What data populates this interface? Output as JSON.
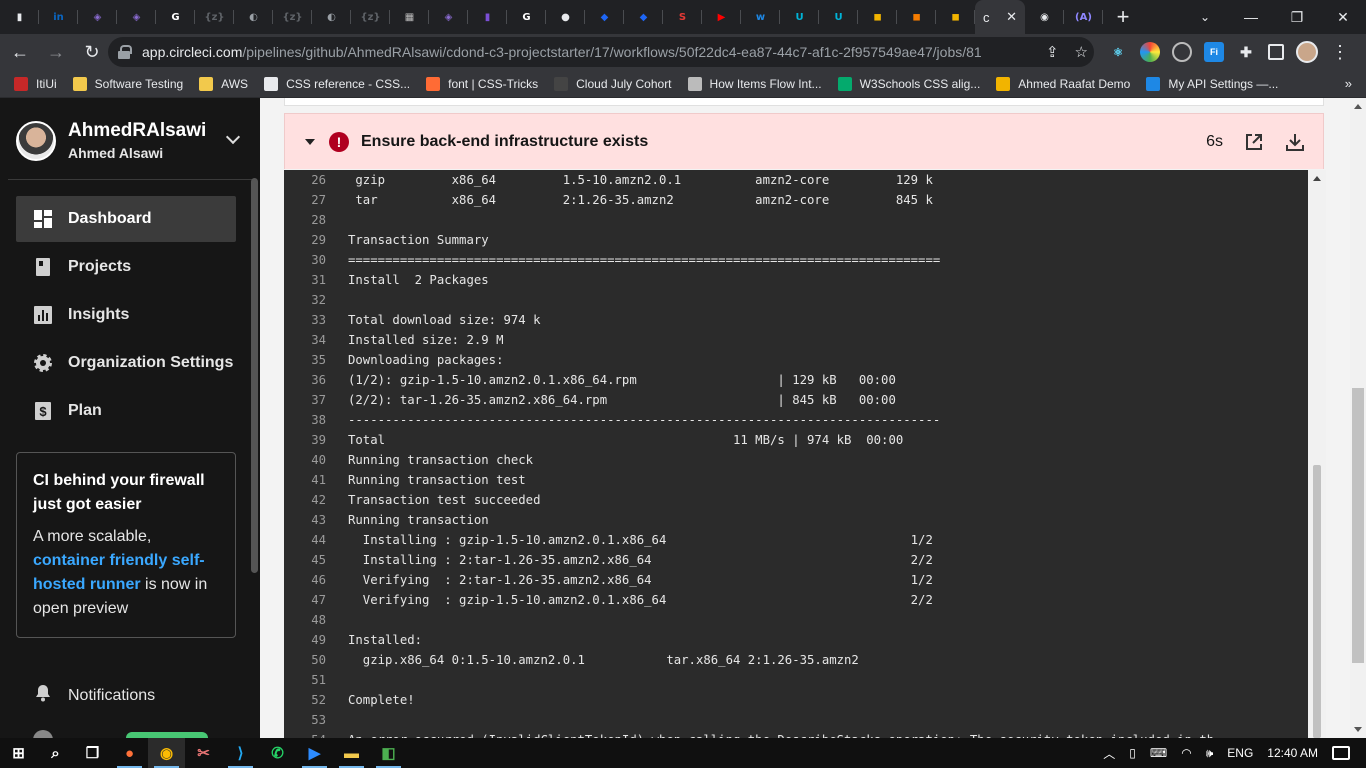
{
  "browser": {
    "active_tab_label": "c",
    "url_host": "app.circleci.com",
    "url_path": "/pipelines/github/AhmedRAlsawi/cdond-c3-projectstarter/17/workflows/50f22dc4-ea87-44c7-af1c-2f957549ae47/jobs/81",
    "pinned_tabs": [
      {
        "icon": "bookmark-icon",
        "color": "#e8eaed",
        "glyph": "▮"
      },
      {
        "icon": "linkedin-icon",
        "color": "#0a66c2",
        "glyph": "in"
      },
      {
        "icon": "graphql-icon",
        "color": "#8a6bd1",
        "glyph": "◈"
      },
      {
        "icon": "graphql-icon",
        "color": "#8a6bd1",
        "glyph": "◈"
      },
      {
        "icon": "google-icon",
        "color": "#ffffff",
        "glyph": "G"
      },
      {
        "icon": "zeplin-icon",
        "color": "#5f6368",
        "glyph": "{z}"
      },
      {
        "icon": "globe-icon",
        "color": "#9aa0a6",
        "glyph": "◐"
      },
      {
        "icon": "zeplin-icon",
        "color": "#5f6368",
        "glyph": "{z}"
      },
      {
        "icon": "globe-icon",
        "color": "#9aa0a6",
        "glyph": "◐"
      },
      {
        "icon": "zeplin-icon",
        "color": "#5f6368",
        "glyph": "{z}"
      },
      {
        "icon": "image-icon",
        "color": "#bdbdbd",
        "glyph": "▦"
      },
      {
        "icon": "graphql-icon",
        "color": "#8a6bd1",
        "glyph": "◈"
      },
      {
        "icon": "onenote-icon",
        "color": "#7b4fd6",
        "glyph": "▮"
      },
      {
        "icon": "google-icon",
        "color": "#ffffff",
        "glyph": "G"
      },
      {
        "icon": "github-icon",
        "color": "#e8eaed",
        "glyph": "●"
      },
      {
        "icon": "layer-icon",
        "color": "#1e66f5",
        "glyph": "◆"
      },
      {
        "icon": "layer-icon",
        "color": "#1e66f5",
        "glyph": "◆"
      },
      {
        "icon": "s-icon",
        "color": "#e53935",
        "glyph": "S"
      },
      {
        "icon": "youtube-icon",
        "color": "#ff0000",
        "glyph": "▶"
      },
      {
        "icon": "w-icon",
        "color": "#1e88e5",
        "glyph": "w"
      },
      {
        "icon": "udacity-icon",
        "color": "#00b4d8",
        "glyph": "U"
      },
      {
        "icon": "udacity-icon",
        "color": "#00b4d8",
        "glyph": "U"
      },
      {
        "icon": "box-icon",
        "color": "#f2b400",
        "glyph": "◼"
      },
      {
        "icon": "box-icon",
        "color": "#f57c00",
        "glyph": "◼"
      },
      {
        "icon": "box-icon",
        "color": "#f2b400",
        "glyph": "◼"
      }
    ],
    "after_tabs": [
      {
        "icon": "circleci-icon",
        "color": "#e8eaed",
        "glyph": "◉"
      },
      {
        "icon": "angular-icon",
        "color": "#8f87ff",
        "glyph": "(A)"
      }
    ],
    "bookmarks": [
      {
        "label": "ItiUi",
        "icon": "iti-icon",
        "color": "#c62828"
      },
      {
        "label": "Software Testing",
        "icon": "folder-icon",
        "color": "#f2c94c"
      },
      {
        "label": "AWS",
        "icon": "folder-icon",
        "color": "#f2c94c"
      },
      {
        "label": "CSS reference - CSS...",
        "icon": "m-icon",
        "color": "#e8eaed"
      },
      {
        "label": "font | CSS-Tricks",
        "icon": "star-icon",
        "color": "#ff6b35"
      },
      {
        "label": "Cloud July Cohort",
        "icon": "cloud-icon",
        "color": "#444"
      },
      {
        "label": "How Items Flow Int...",
        "icon": "flow-icon",
        "color": "#bbb"
      },
      {
        "label": "W3Schools CSS alig...",
        "icon": "w3schools-icon",
        "color": "#04aa6d"
      },
      {
        "label": "Ahmed Raafat Demo",
        "icon": "ahmed-icon",
        "color": "#f2b400"
      },
      {
        "label": "My API Settings —...",
        "icon": "api-icon",
        "color": "#1e88e5"
      }
    ],
    "bookmarks_more": "»"
  },
  "sidebar": {
    "org_name": "AhmedRAlsawi",
    "user_name": "Ahmed Alsawi",
    "nav": [
      {
        "label": "Dashboard",
        "icon": "dashboard-icon",
        "active": true
      },
      {
        "label": "Projects",
        "icon": "projects-icon",
        "active": false
      },
      {
        "label": "Insights",
        "icon": "insights-icon",
        "active": false
      },
      {
        "label": "Organization Settings",
        "icon": "gear-icon",
        "active": false
      },
      {
        "label": "Plan",
        "icon": "plan-icon",
        "active": false
      }
    ],
    "promo": {
      "title": "CI behind your firewall just got easier",
      "body_before": "A more scalable, ",
      "link": "container friendly self-hosted runner",
      "body_after": " is now in open preview"
    },
    "notifications": "Notifications"
  },
  "step": {
    "title": "Ensure back-end infrastructure exists",
    "duration": "6s"
  },
  "console": {
    "lines": [
      {
        "n": "26",
        "t": " gzip         x86_64         1.5-10.amzn2.0.1          amzn2-core         129 k"
      },
      {
        "n": "27",
        "t": " tar          x86_64         2:1.26-35.amzn2           amzn2-core         845 k"
      },
      {
        "n": "28",
        "t": ""
      },
      {
        "n": "29",
        "t": "Transaction Summary"
      },
      {
        "n": "30",
        "t": "================================================================================"
      },
      {
        "n": "31",
        "t": "Install  2 Packages"
      },
      {
        "n": "32",
        "t": ""
      },
      {
        "n": "33",
        "t": "Total download size: 974 k"
      },
      {
        "n": "34",
        "t": "Installed size: 2.9 M"
      },
      {
        "n": "35",
        "t": "Downloading packages:"
      },
      {
        "n": "36",
        "t": "(1/2): gzip-1.5-10.amzn2.0.1.x86_64.rpm                   | 129 kB   00:00"
      },
      {
        "n": "37",
        "t": "(2/2): tar-1.26-35.amzn2.x86_64.rpm                       | 845 kB   00:00"
      },
      {
        "n": "38",
        "t": "--------------------------------------------------------------------------------"
      },
      {
        "n": "39",
        "t": "Total                                               11 MB/s | 974 kB  00:00"
      },
      {
        "n": "40",
        "t": "Running transaction check"
      },
      {
        "n": "41",
        "t": "Running transaction test"
      },
      {
        "n": "42",
        "t": "Transaction test succeeded"
      },
      {
        "n": "43",
        "t": "Running transaction"
      },
      {
        "n": "44",
        "t": "  Installing : gzip-1.5-10.amzn2.0.1.x86_64                                 1/2"
      },
      {
        "n": "45",
        "t": "  Installing : 2:tar-1.26-35.amzn2.x86_64                                   2/2"
      },
      {
        "n": "46",
        "t": "  Verifying  : 2:tar-1.26-35.amzn2.x86_64                                   1/2"
      },
      {
        "n": "47",
        "t": "  Verifying  : gzip-1.5-10.amzn2.0.1.x86_64                                 2/2"
      },
      {
        "n": "48",
        "t": ""
      },
      {
        "n": "49",
        "t": "Installed:"
      },
      {
        "n": "50",
        "t": "  gzip.x86_64 0:1.5-10.amzn2.0.1           tar.x86_64 2:1.26-35.amzn2"
      },
      {
        "n": "51",
        "t": ""
      },
      {
        "n": "52",
        "t": "Complete!"
      },
      {
        "n": "53",
        "t": ""
      },
      {
        "n": "54",
        "t": "An error occurred (InvalidClientTokenId) when calling the DescribeStacks operation: The security token included in th"
      }
    ]
  },
  "taskbar": {
    "lang": "ENG",
    "time": "12:40 AM",
    "apps": [
      {
        "icon": "windows-start-icon",
        "color": "#ffffff",
        "glyph": "⊞"
      },
      {
        "icon": "search-icon",
        "color": "#ffffff",
        "glyph": "⌕"
      },
      {
        "icon": "task-view-icon",
        "color": "#ffffff",
        "glyph": "❐"
      },
      {
        "icon": "firefox-icon",
        "color": "#ff7139",
        "glyph": "●"
      },
      {
        "icon": "chrome-icon",
        "color": "#fbbc04",
        "glyph": "◉"
      },
      {
        "icon": "snip-icon",
        "color": "#e57373",
        "glyph": "✂"
      },
      {
        "icon": "vscode-icon",
        "color": "#23a9f2",
        "glyph": "⟩"
      },
      {
        "icon": "whatsapp-icon",
        "color": "#25d366",
        "glyph": "✆"
      },
      {
        "icon": "zoom-icon",
        "color": "#2d8cff",
        "glyph": "▶"
      },
      {
        "icon": "file-explorer-icon",
        "color": "#f2c94c",
        "glyph": "▬"
      },
      {
        "icon": "sourcetree-icon",
        "color": "#4caf50",
        "glyph": "◧"
      }
    ]
  }
}
